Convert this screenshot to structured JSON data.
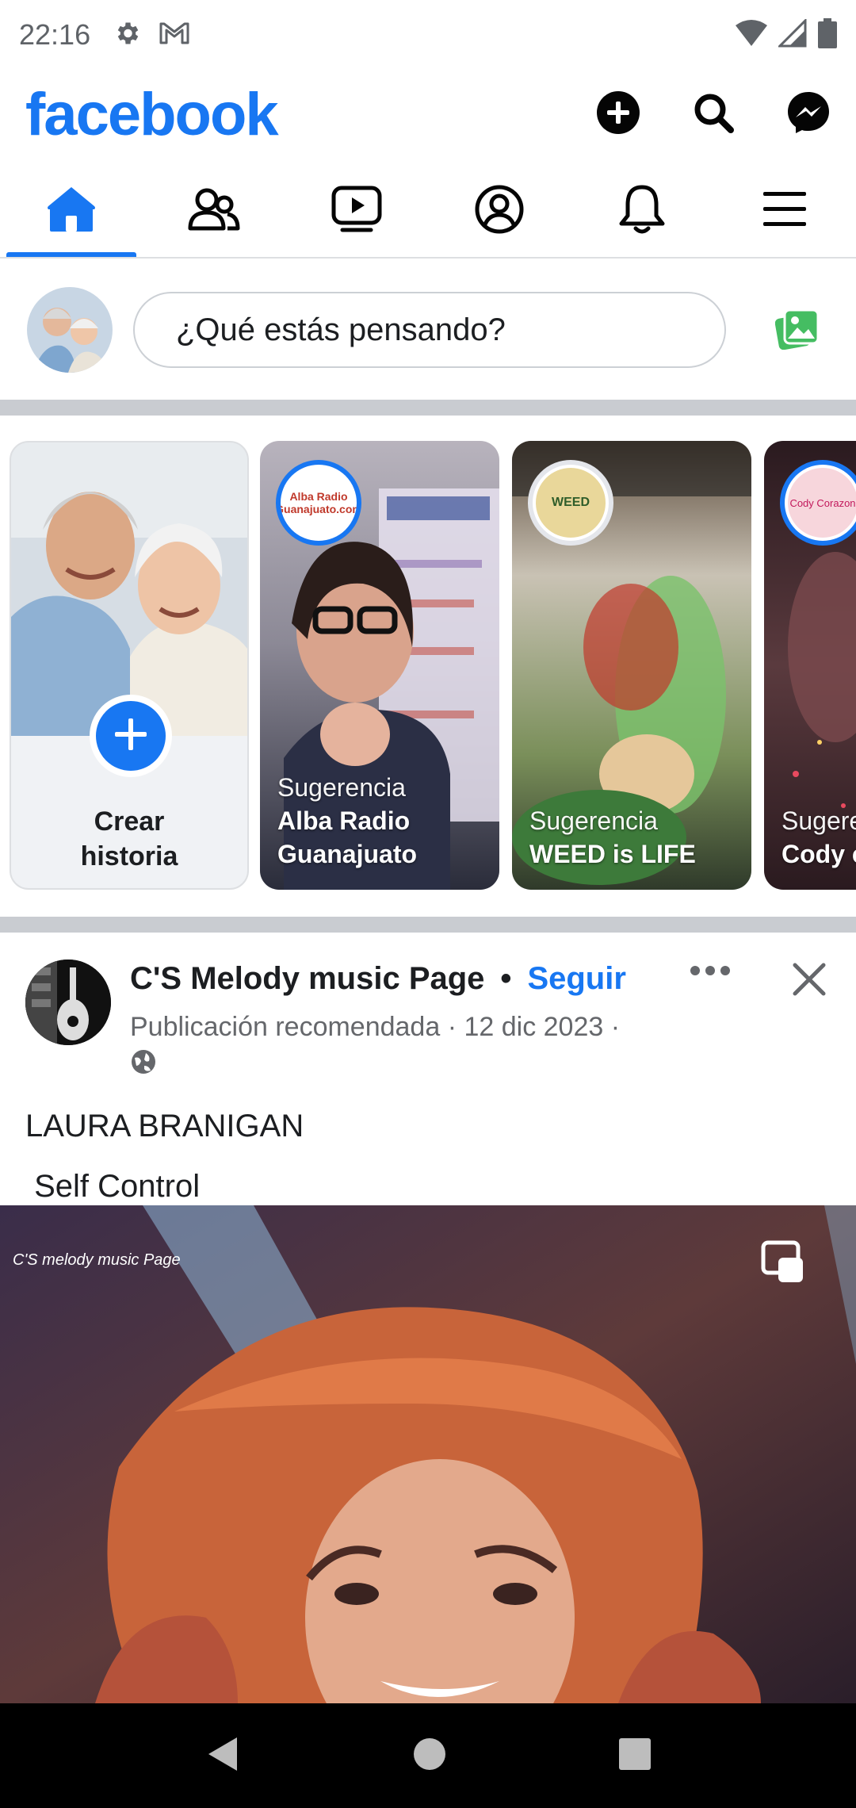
{
  "status_bar": {
    "time": "22:16"
  },
  "header": {
    "logo": "facebook"
  },
  "nav_tabs": [
    "home",
    "friends",
    "watch",
    "profile",
    "notifications",
    "menu"
  ],
  "composer": {
    "placeholder": "¿Qué estás pensando?"
  },
  "stories": {
    "create": {
      "line1": "Crear",
      "line2": "historia"
    },
    "items": [
      {
        "badge": "Sugerencia",
        "name_line1": "Alba Radio",
        "name_line2": "Guanajuato",
        "ring_text": "Alba Radio Guanajuato.com"
      },
      {
        "badge": "Sugerencia",
        "name_line1": "WEED is LIFE",
        "name_line2": "",
        "ring_text": "WEED"
      },
      {
        "badge": "Sugere",
        "name_line1": "Cody c",
        "name_line2": "",
        "ring_text": "Cody Corazon"
      }
    ]
  },
  "post": {
    "page_name": "C'S Melody music Page",
    "separator": "•",
    "follow_label": "Seguir",
    "meta": "Publicación recomendada · 12 dic 2023 ·",
    "text_line1": "LAURA BRANIGAN",
    "text_line2": " Self Control",
    "watermark": "C'S melody music Page"
  },
  "colors": {
    "brand": "#1877f2",
    "divider": "#c9ccd1"
  }
}
